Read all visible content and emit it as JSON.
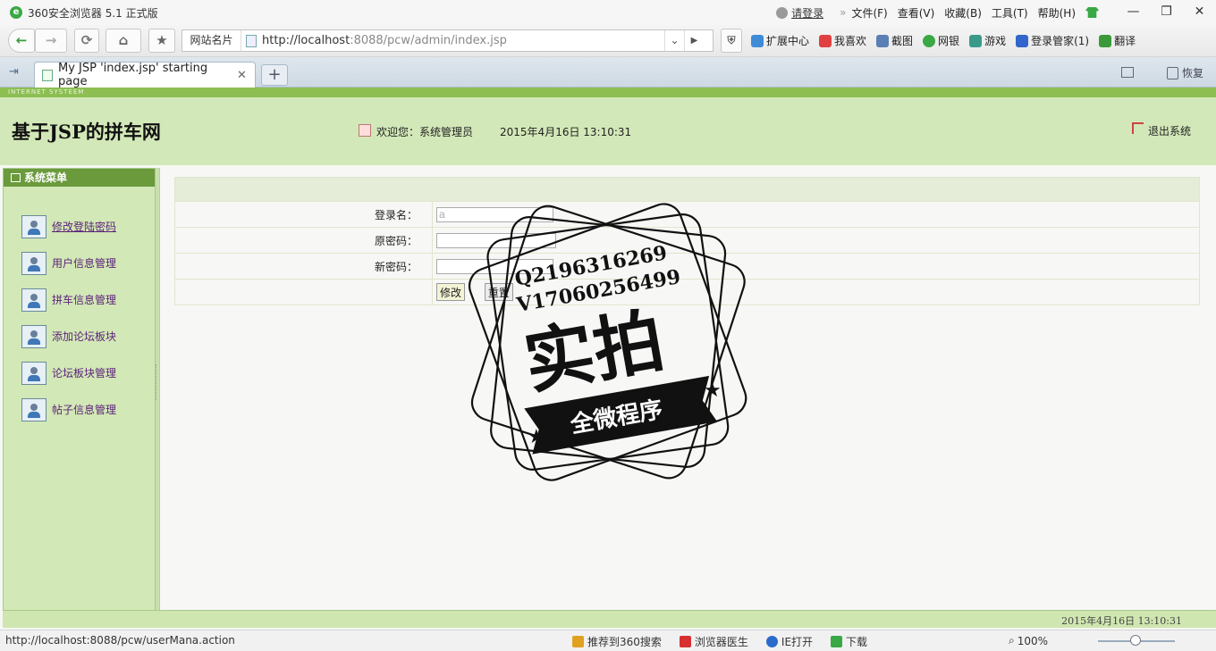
{
  "browser": {
    "title": "360安全浏览器 5.1 正式版",
    "login_link": "请登录",
    "menu": [
      "文件(F)",
      "查看(V)",
      "收藏(B)",
      "工具(T)",
      "帮助(H)"
    ],
    "window_buttons": [
      "—",
      "❐",
      "✕"
    ],
    "site_card": "网站名片",
    "url_host": "http://localhost",
    "url_rest": ":8088/pcw/admin/index.jsp",
    "toolbar_items": [
      {
        "label": "扩展中心",
        "color": "#3f8bd8"
      },
      {
        "label": "我喜欢",
        "color": "#e04040"
      },
      {
        "label": "截图",
        "color": "#5a7fb5"
      },
      {
        "label": "网银",
        "color": "#3aa845"
      },
      {
        "label": "游戏",
        "color": "#3a9a8a"
      },
      {
        "label": "登录管家(1)",
        "color": "#3366cc"
      },
      {
        "label": "翻译",
        "color": "#3a9a3a"
      }
    ],
    "tab_title": "My JSP 'index.jsp' starting page",
    "restore_label": "恢复",
    "status_url": "http://localhost:8088/pcw/userMana.action",
    "status_items": [
      {
        "label": "推荐到360搜索",
        "color": "#e0a020"
      },
      {
        "label": "浏览器医生",
        "color": "#d83030"
      },
      {
        "label": "IE打开",
        "color": "#2a6acb"
      },
      {
        "label": "下载",
        "color": "#3aa845"
      }
    ],
    "zoom": "100%"
  },
  "page": {
    "strip_text": "INTERNET SYSTEEM",
    "site_title": "基于JSP的拼车网",
    "welcome": "欢迎您：系统管理员",
    "datetime": "2015年4月16日  13:10:31",
    "logout": "退出系统",
    "footer_datetime": "2015年4月16日  13:10:31"
  },
  "sidebar": {
    "heading": "系统菜单",
    "items": [
      {
        "label": "修改登陆密码"
      },
      {
        "label": "用户信息管理"
      },
      {
        "label": "拼车信息管理"
      },
      {
        "label": "添加论坛板块"
      },
      {
        "label": "论坛板块管理"
      },
      {
        "label": "帖子信息管理"
      }
    ]
  },
  "form": {
    "login_label": "登录名：",
    "login_value": "a",
    "old_pw_label": "原密码：",
    "new_pw_label": "新密码：",
    "submit": "修改",
    "reset": "重置"
  },
  "watermark": {
    "line1": "Q2196316269",
    "line2": "V17060256499",
    "big": "实拍",
    "ribbon": "全微程序"
  }
}
